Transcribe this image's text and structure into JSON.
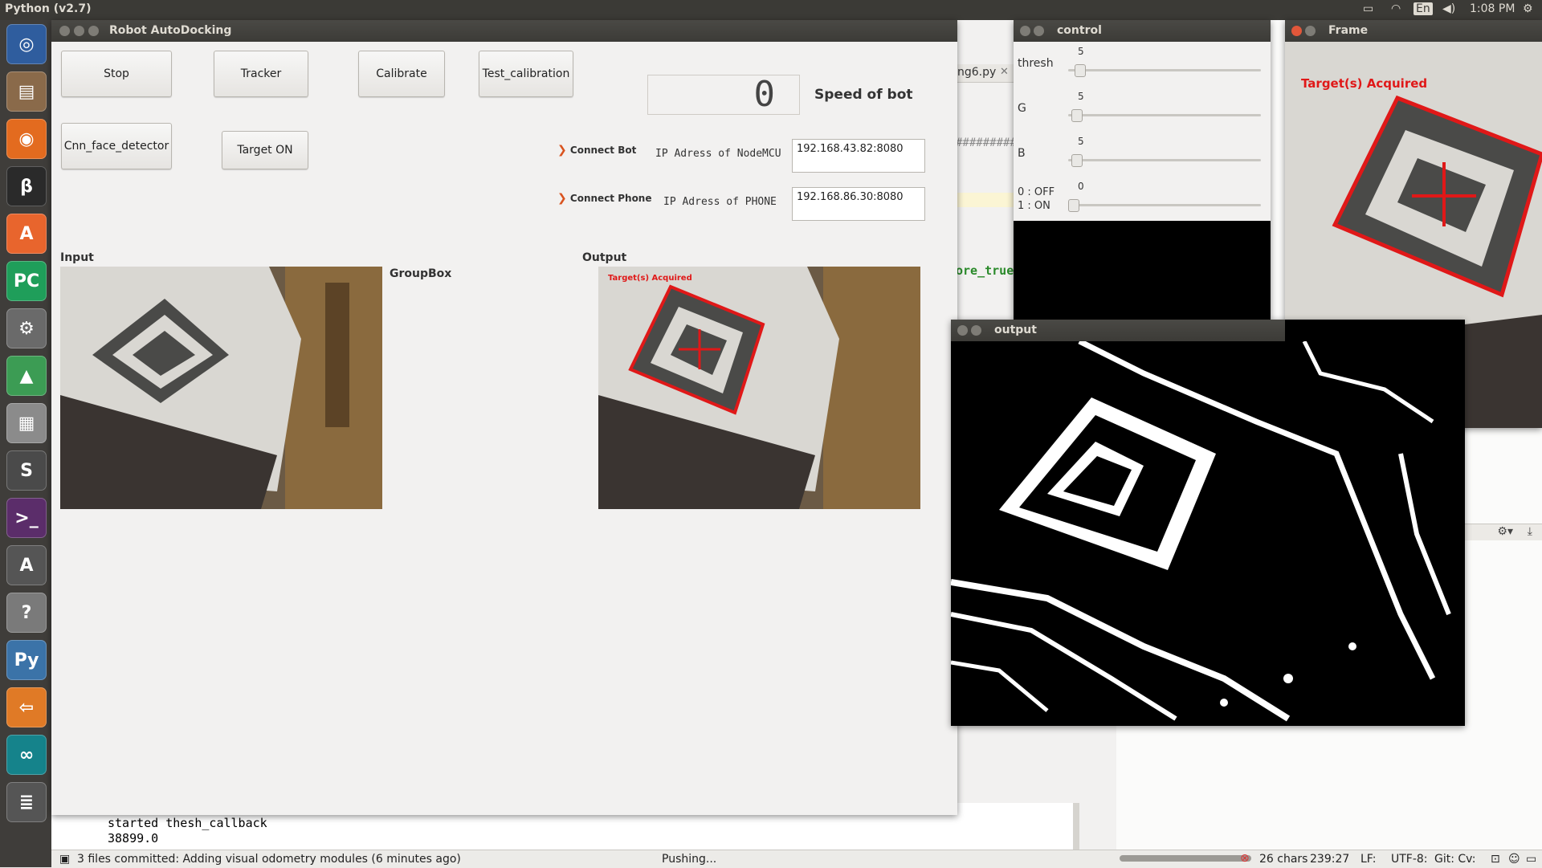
{
  "top_panel": {
    "app_title": "Python (v2.7)",
    "keyboard": "En",
    "time": "1:08 PM"
  },
  "launcher": {
    "icons": [
      {
        "name": "ubuntu-dash-icon",
        "glyph": "◎",
        "color": "#2f5d9e"
      },
      {
        "name": "files-icon",
        "glyph": "▤",
        "color": "#8a6a4a"
      },
      {
        "name": "firefox-icon",
        "glyph": "◉",
        "color": "#e36b1f"
      },
      {
        "name": "pycharm-edu-icon",
        "glyph": "β",
        "color": "#2a2a2a"
      },
      {
        "name": "software-center-icon",
        "glyph": "A",
        "color": "#e8652d"
      },
      {
        "name": "pycharm-icon",
        "glyph": "PC",
        "color": "#1f9e5a"
      },
      {
        "name": "system-settings-icon",
        "glyph": "⚙",
        "color": "#6a6a6a"
      },
      {
        "name": "android-studio-icon",
        "glyph": "▲",
        "color": "#3c9c54"
      },
      {
        "name": "scanner-icon",
        "glyph": "▦",
        "color": "#8b8b8b"
      },
      {
        "name": "sublime-text-icon",
        "glyph": "S",
        "color": "#4a4a4a"
      },
      {
        "name": "terminal-icon",
        "glyph": ">_",
        "color": "#5b2d6a"
      },
      {
        "name": "software-updater-icon",
        "glyph": "A",
        "color": "#555"
      },
      {
        "name": "help-icon",
        "glyph": "?",
        "color": "#7a7a7a"
      },
      {
        "name": "python-icon",
        "glyph": "Py",
        "color": "#3b73a8"
      },
      {
        "name": "back-arrow-icon",
        "glyph": "⇦",
        "color": "#e07a26"
      },
      {
        "name": "arduino-icon",
        "glyph": "∞",
        "color": "#15838b"
      },
      {
        "name": "stack-icon",
        "glyph": "≣",
        "color": "#555"
      }
    ]
  },
  "ide": {
    "tab_name": "ng6.py",
    "code_fragment": "#########",
    "code_fragment2": "ore_true'",
    "console_lines": [
      "started thesh_callback",
      "38899.0"
    ]
  },
  "status_bar": {
    "commit_msg": "3 files committed: Adding visual odometry modules (6 minutes ago)",
    "pushing": "Pushing...",
    "chars": "26 chars",
    "position": "239:27",
    "line_sep": "LF:",
    "encoding": "UTF-8:",
    "git": "Git: Cv:"
  },
  "main_window": {
    "title": "Robot AutoDocking",
    "buttons": {
      "stop": "Stop",
      "tracker": "Tracker",
      "calibrate": "Calibrate",
      "test_calibration": "Test_calibration",
      "cnn_face_detector": "Cnn_face_detector",
      "target_on": "Target ON"
    },
    "speed_display": "0",
    "speed_label": "Speed of bot",
    "connect_bot": "Connect Bot",
    "connect_phone": "Connect Phone",
    "ip_nodemcu_label": "IP Adress of NodeMCU",
    "ip_nodemcu_value": "192.168.43.82:8080",
    "ip_phone_label": "IP Adress of PHONE",
    "ip_phone_value": "192.168.86.30:8080",
    "input_label": "Input",
    "groupbox_label": "GroupBox",
    "output_label": "Output",
    "overlay_text": "Target(s) Acquired"
  },
  "control_window": {
    "title": "control",
    "sliders": [
      {
        "label": "thresh",
        "value": "5"
      },
      {
        "label": "G",
        "value": "5"
      },
      {
        "label": "B",
        "value": "5"
      },
      {
        "label": "0 : OFF",
        "label2": "1 : ON",
        "value": "0"
      }
    ]
  },
  "frame_window": {
    "title": "Frame",
    "overlay_text": "Target(s) Acquired"
  },
  "output_window": {
    "title": "output"
  }
}
